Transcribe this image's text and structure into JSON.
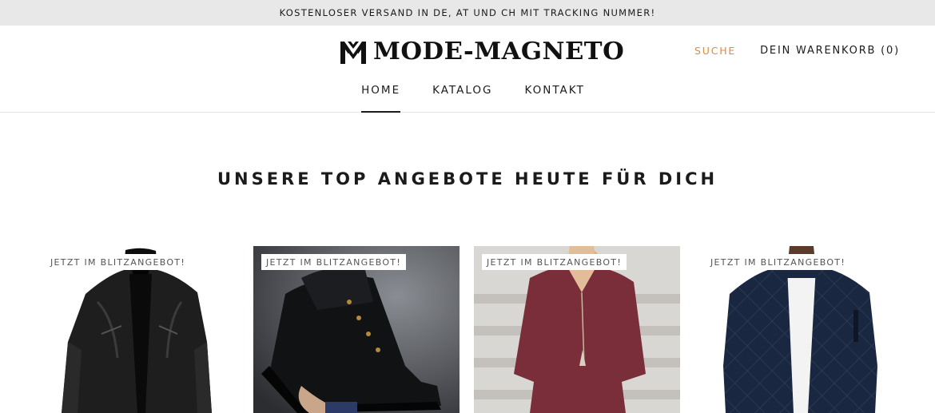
{
  "announcement": {
    "text": "KOSTENLOSER VERSAND IN DE, AT UND CH MIT TRACKING NUMMER!"
  },
  "header": {
    "logo_icon": "mm-monogram-icon",
    "logo_text": "MODE-MAGNETO",
    "search_label": "SUCHE",
    "cart_label": "DEIN WARENKORB (0)",
    "colors": {
      "search": "#e08a3a",
      "text": "#1c1b1b",
      "announcement_bg": "#e8e8e8"
    }
  },
  "nav": {
    "items": [
      {
        "label": "HOME",
        "active": true
      },
      {
        "label": "KATALOG",
        "active": false
      },
      {
        "label": "KONTAKT",
        "active": false
      }
    ]
  },
  "main": {
    "section_title": "UNSERE TOP ANGEBOTE HEUTE FÜR DICH",
    "products": [
      {
        "badge": "JETZT IM BLITZANGEBOT!",
        "image": "black-leather-jacket"
      },
      {
        "badge": "JETZT IM BLITZANGEBOT!",
        "image": "black-boot-in-hand"
      },
      {
        "badge": "JETZT IM BLITZANGEBOT!",
        "image": "burgundy-dress"
      },
      {
        "badge": "JETZT IM BLITZANGEBOT!",
        "image": "navy-quilted-jacket"
      }
    ]
  }
}
